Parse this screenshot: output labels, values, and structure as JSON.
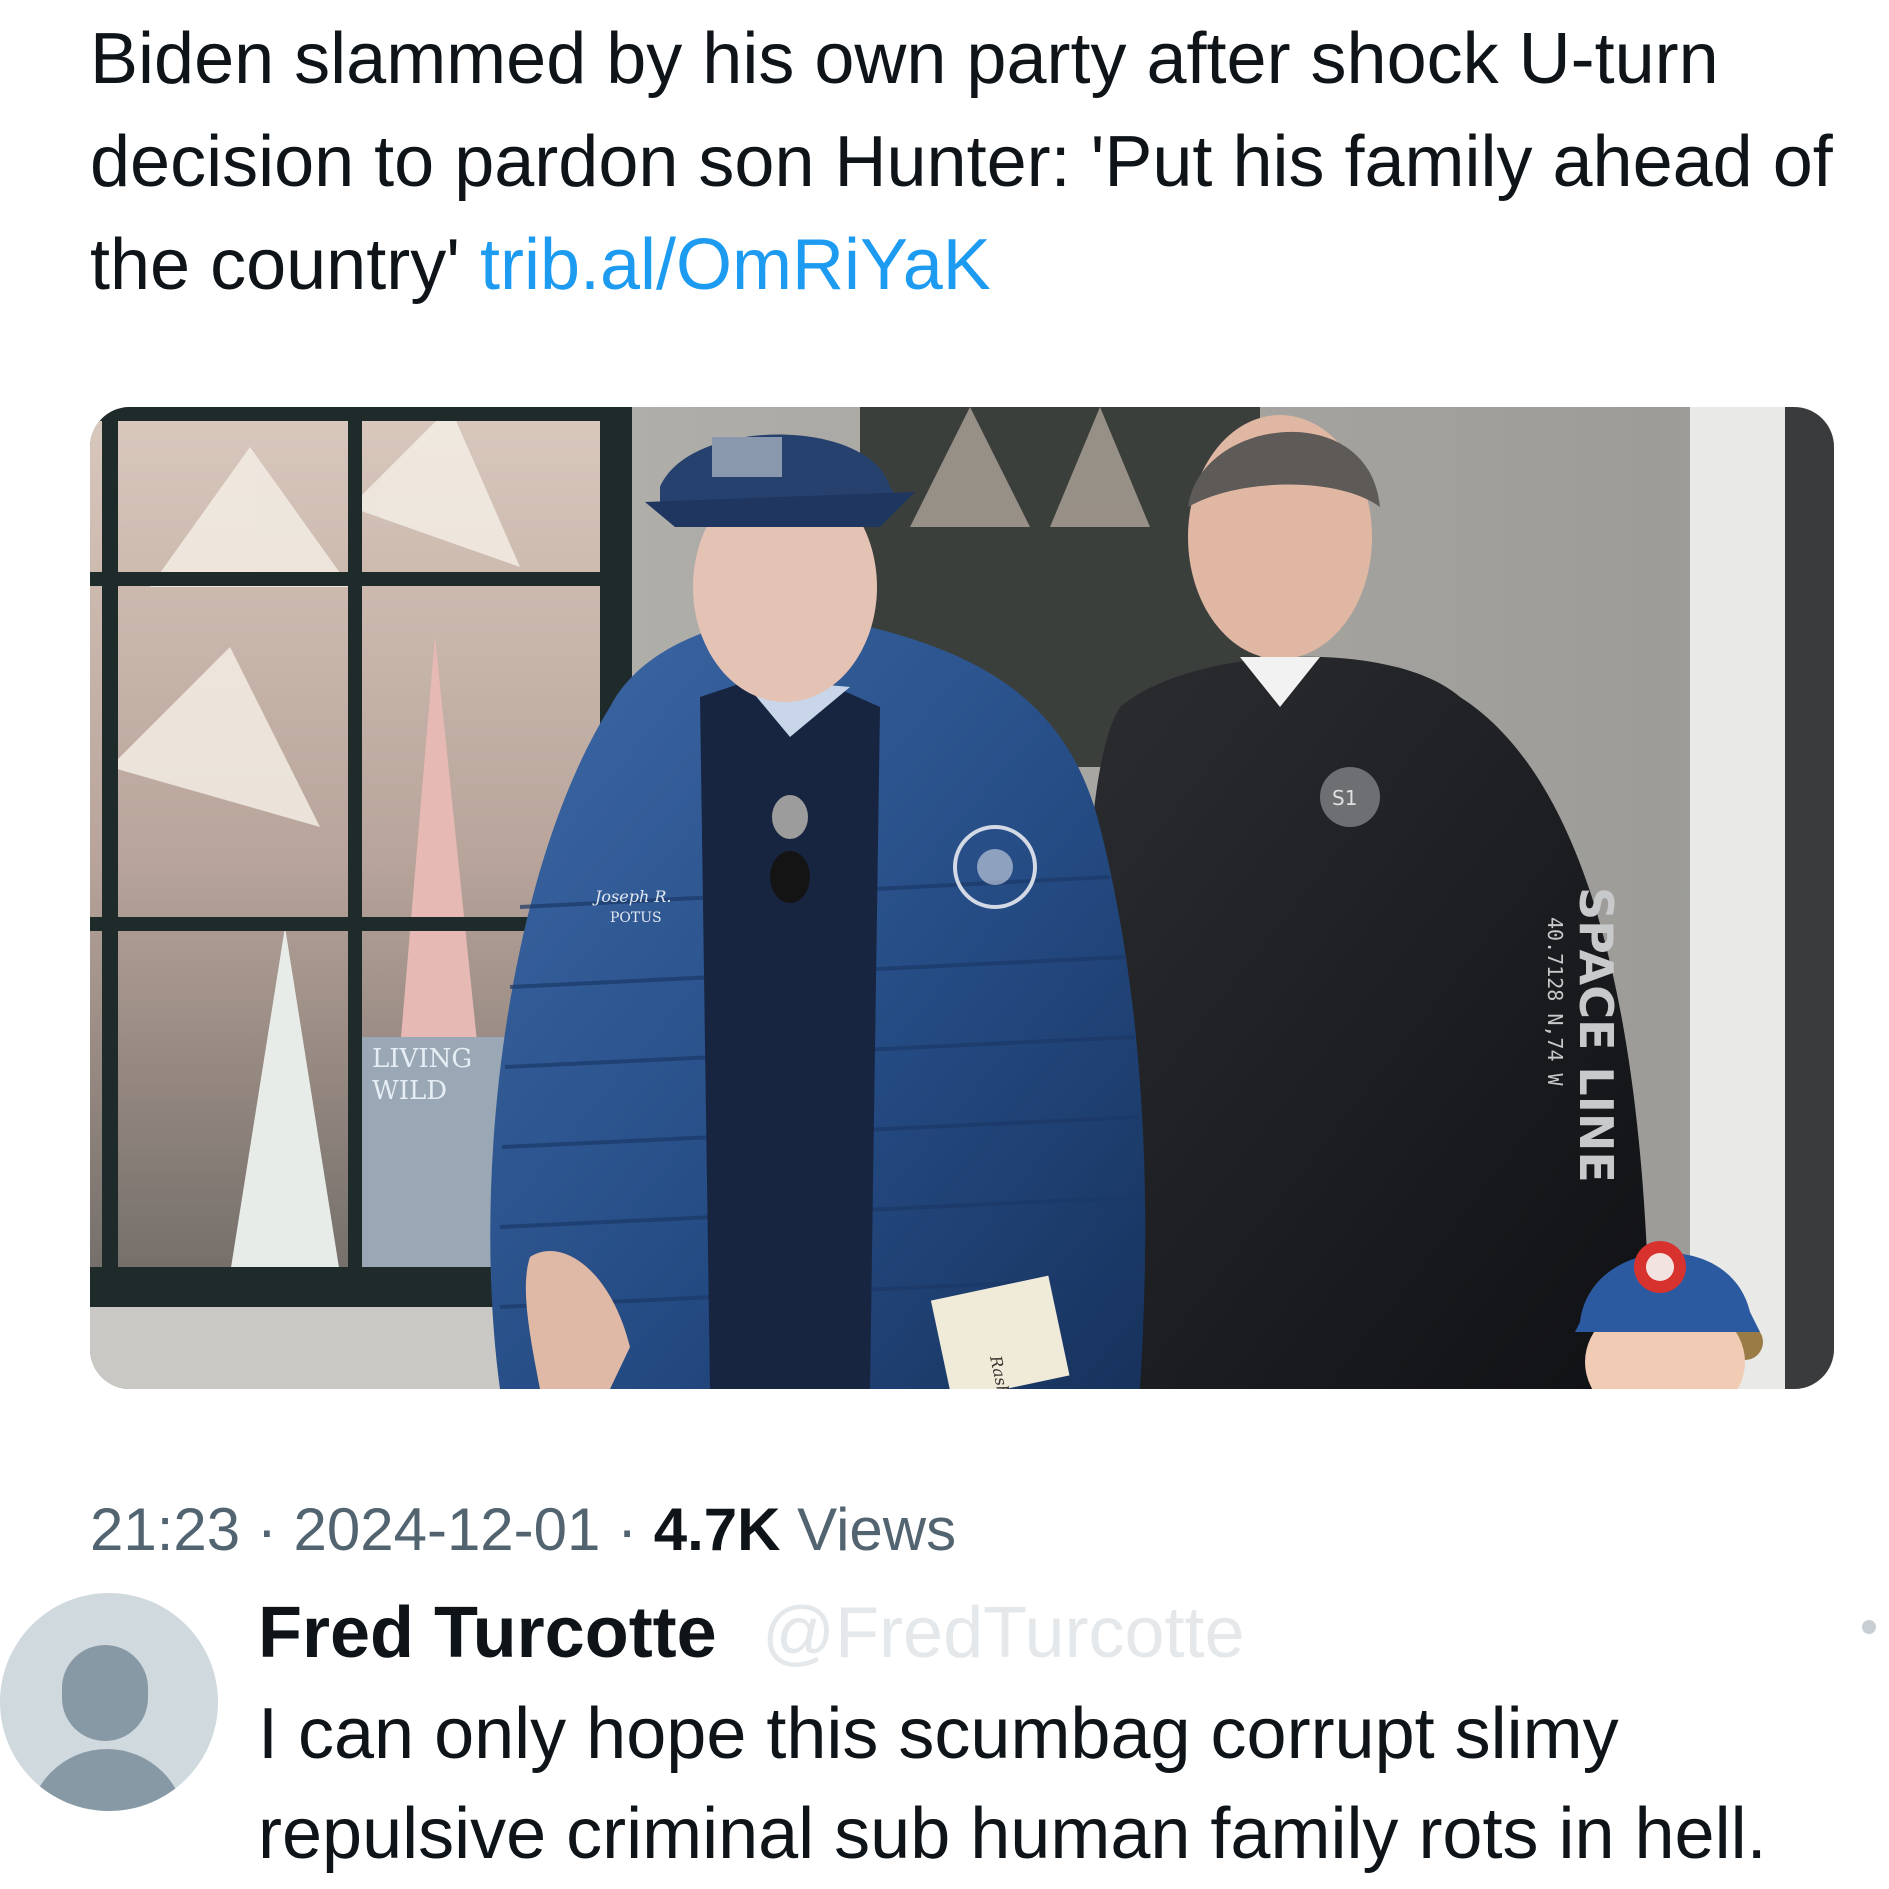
{
  "tweet": {
    "text": "Biden slammed by his own party after shock U-turn decision to pardon son Hunter: 'Put his family ahead of the country'",
    "link": "trib.al/OmRiYaK",
    "media": {
      "jacket_name": "Joseph R.",
      "jacket_title": "POTUS",
      "sign_line1": "LIVING",
      "sign_line2": "WILD",
      "sleeve_text": "SPACE LINE",
      "sleeve_coords": "40.7128 N,74 W",
      "patch_text": "S1",
      "book_text": "Rashid Kh"
    },
    "meta": {
      "time": "21:23",
      "sep1": " · ",
      "date": "2024-12-01",
      "sep2": " · ",
      "views_count": "4.7K",
      "views_label": " Views"
    }
  },
  "reply": {
    "name": "Fred Turcotte",
    "handle": "@FredTurcotte",
    "text": "I can only hope this scumbag corrupt slimy repulsive criminal sub human family rots in hell."
  }
}
